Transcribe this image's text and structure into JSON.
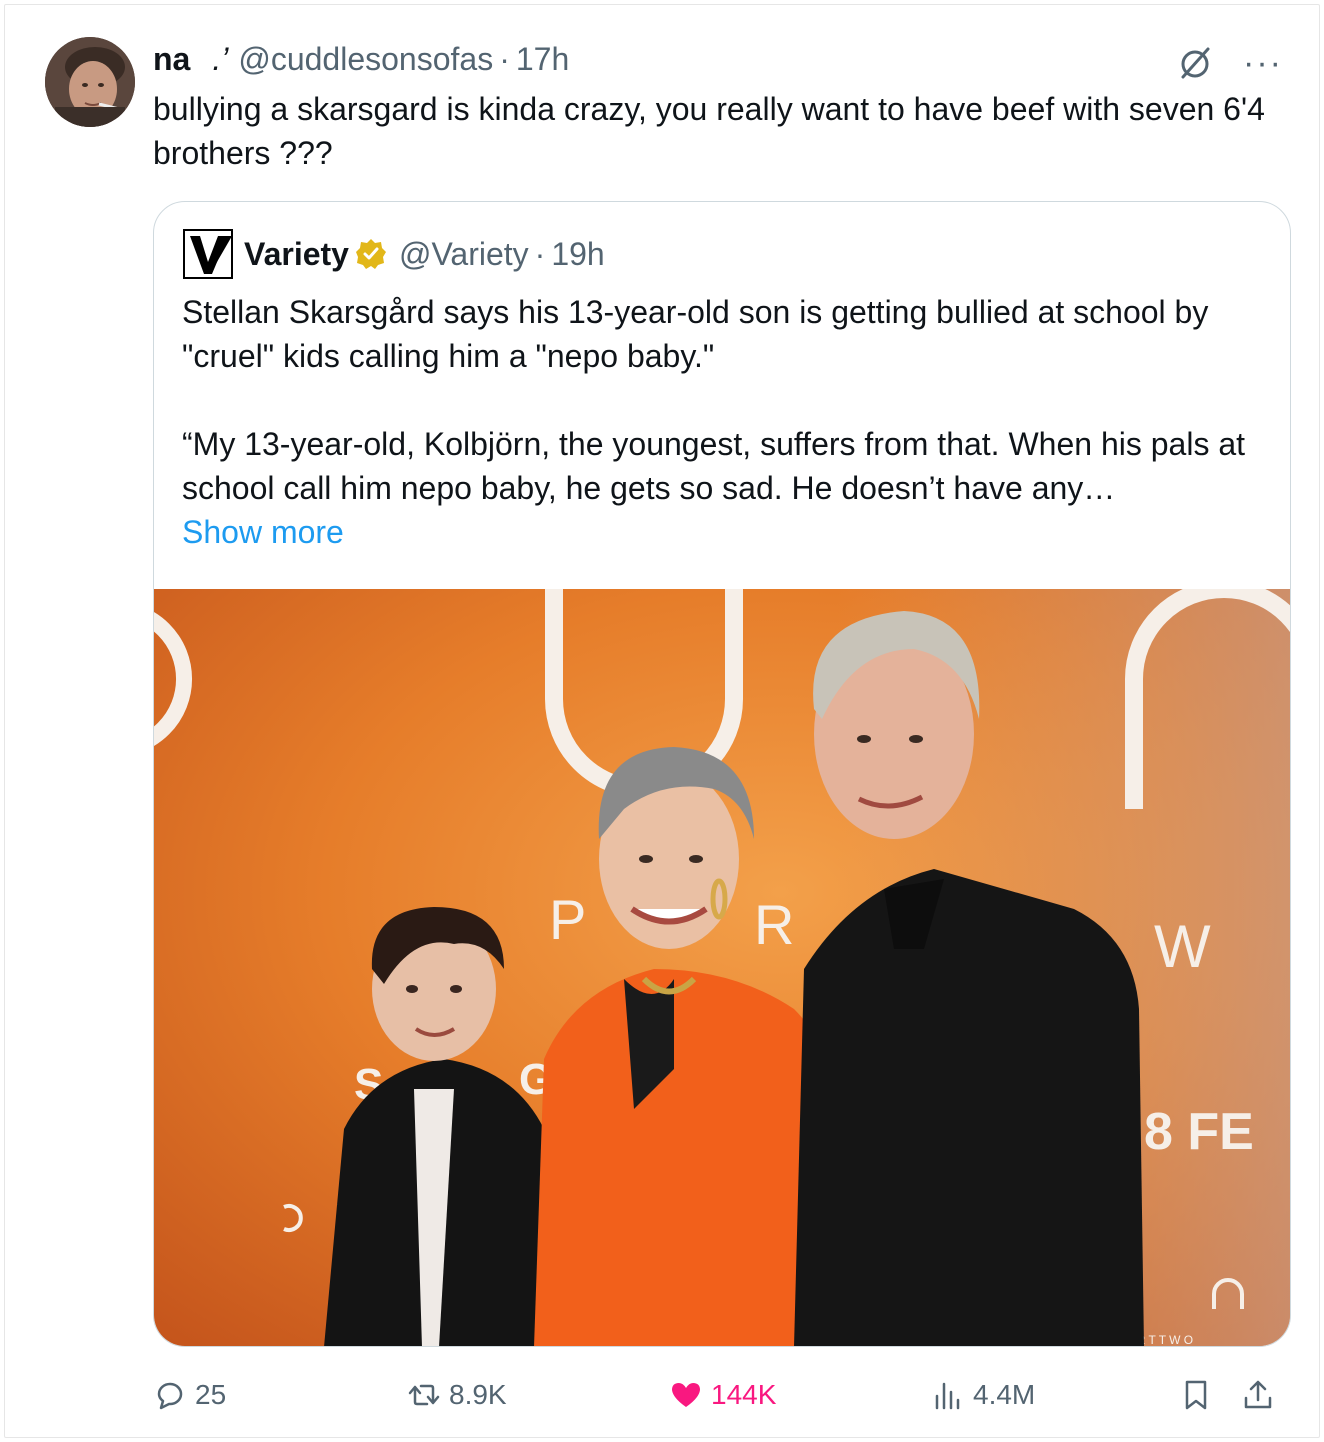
{
  "tweet": {
    "author_name": "na",
    "author_symbol": ".’",
    "handle": "@cuddlesonsofas",
    "time": "17h",
    "text": "bullying a skarsgard is kinda crazy, you really want to have beef with seven 6'4 brothers ???"
  },
  "quote": {
    "author_name": "Variety",
    "handle": "@Variety",
    "time": "19h",
    "paragraph1": "Stellan Skarsgård says his 13-year-old son is getting bullied at school by \"cruel\" kids calling him a \"nepo baby.\"",
    "paragraph2": "“My 13-year-old, Kolbjörn, the youngest, suffers from that. When his pals at school call him nepo baby, he gets so sad. He doesn’t have any…",
    "show_more": "Show more",
    "photo_backdrop_letters": [
      "P",
      "R",
      "W",
      "S",
      "G",
      "8 FE",
      "A R T   T W O"
    ]
  },
  "actions": {
    "replies": "25",
    "retweets": "8.9K",
    "likes": "144K",
    "views": "4.4M"
  },
  "icons": {
    "grok": "grok-icon",
    "more": "more-icon",
    "reply": "reply-icon",
    "retweet": "retweet-icon",
    "like": "heart-icon",
    "views": "views-icon",
    "bookmark": "bookmark-icon",
    "share": "share-icon",
    "verified": "verified-badge-icon"
  },
  "colors": {
    "text": "#0f1419",
    "secondary": "#536471",
    "link": "#1d9bf0",
    "like": "#f91880",
    "verified": "#e2b719",
    "border": "#cfd9de"
  }
}
